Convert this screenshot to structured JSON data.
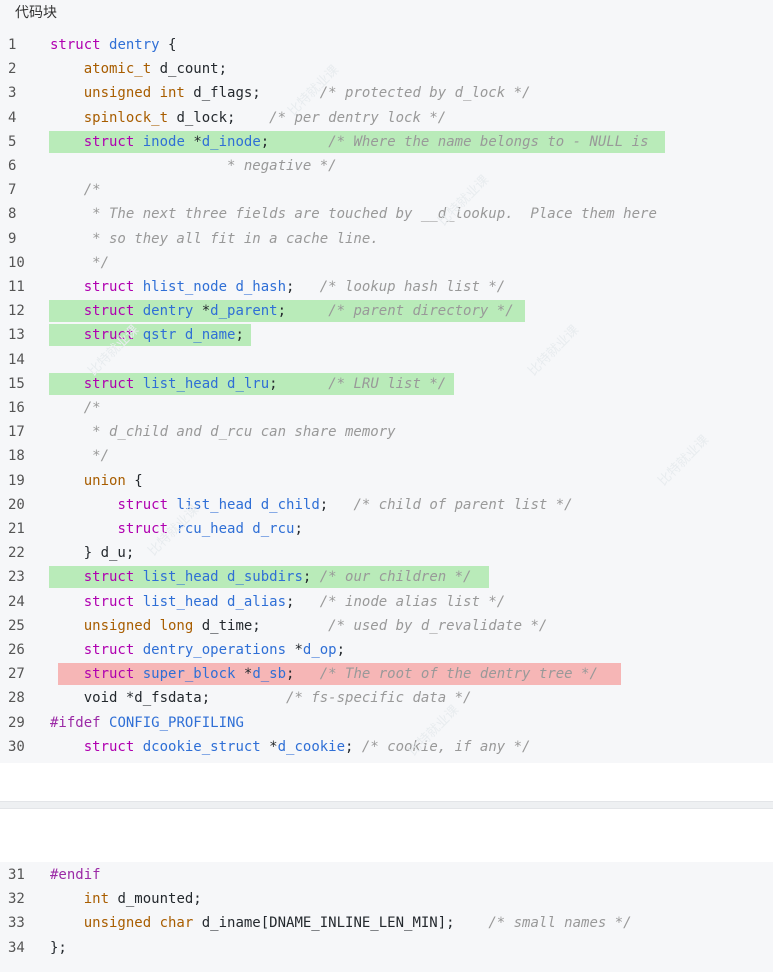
{
  "header": {
    "title": "代码块"
  },
  "code_block_1": {
    "lines": [
      {
        "num": "1",
        "hl": "",
        "tokens": [
          {
            "c": "st",
            "t": "struct "
          },
          {
            "c": "ty",
            "t": "dentry"
          },
          {
            "c": "pl",
            "t": " {"
          }
        ]
      },
      {
        "num": "2",
        "hl": "",
        "tokens": [
          {
            "c": "pl",
            "t": "    "
          },
          {
            "c": "kw",
            "t": "atomic_t"
          },
          {
            "c": "pl",
            "t": " d_count;"
          }
        ]
      },
      {
        "num": "3",
        "hl": "",
        "tokens": [
          {
            "c": "pl",
            "t": "    "
          },
          {
            "c": "kw",
            "t": "unsigned int"
          },
          {
            "c": "pl",
            "t": " d_flags;       "
          },
          {
            "c": "cm",
            "t": "/* protected by d_lock */"
          }
        ]
      },
      {
        "num": "4",
        "hl": "",
        "tokens": [
          {
            "c": "pl",
            "t": "    "
          },
          {
            "c": "kw",
            "t": "spinlock_t"
          },
          {
            "c": "pl",
            "t": " d_lock;    "
          },
          {
            "c": "cm",
            "t": "/* per dentry lock */"
          }
        ]
      },
      {
        "num": "5",
        "hl": "green",
        "hlw": 616,
        "tokens": [
          {
            "c": "pl",
            "t": "    "
          },
          {
            "c": "st",
            "t": "struct "
          },
          {
            "c": "ty",
            "t": "inode"
          },
          {
            "c": "pl",
            "t": " *"
          },
          {
            "c": "ty",
            "t": "d_inode"
          },
          {
            "c": "pl",
            "t": ";       "
          },
          {
            "c": "cm",
            "t": "/* Where the name belongs to - NULL is"
          }
        ]
      },
      {
        "num": "6",
        "hl": "",
        "tokens": [
          {
            "c": "cm",
            "t": "                     * negative */"
          }
        ]
      },
      {
        "num": "7",
        "hl": "",
        "tokens": [
          {
            "c": "cm",
            "t": "    /*"
          }
        ]
      },
      {
        "num": "8",
        "hl": "",
        "tokens": [
          {
            "c": "cm",
            "t": "     * The next three fields are touched by __d_lookup.  Place them here"
          }
        ]
      },
      {
        "num": "9",
        "hl": "",
        "tokens": [
          {
            "c": "cm",
            "t": "     * so they all fit in a cache line."
          }
        ]
      },
      {
        "num": "10",
        "hl": "",
        "tokens": [
          {
            "c": "cm",
            "t": "     */"
          }
        ]
      },
      {
        "num": "11",
        "hl": "",
        "tokens": [
          {
            "c": "pl",
            "t": "    "
          },
          {
            "c": "st",
            "t": "struct "
          },
          {
            "c": "ty",
            "t": "hlist_node d_hash"
          },
          {
            "c": "pl",
            "t": ";   "
          },
          {
            "c": "cm",
            "t": "/* lookup hash list */"
          }
        ]
      },
      {
        "num": "12",
        "hl": "green",
        "hlw": 476,
        "tokens": [
          {
            "c": "pl",
            "t": "    "
          },
          {
            "c": "st",
            "t": "struct "
          },
          {
            "c": "ty",
            "t": "dentry"
          },
          {
            "c": "pl",
            "t": " *"
          },
          {
            "c": "ty",
            "t": "d_parent"
          },
          {
            "c": "pl",
            "t": ";     "
          },
          {
            "c": "cm",
            "t": "/* parent directory */"
          }
        ]
      },
      {
        "num": "13",
        "hl": "green",
        "hlw": 202,
        "tokens": [
          {
            "c": "pl",
            "t": "    "
          },
          {
            "c": "st",
            "t": "struct "
          },
          {
            "c": "ty",
            "t": "qstr d_name"
          },
          {
            "c": "pl",
            "t": ";"
          }
        ]
      },
      {
        "num": "14",
        "hl": "",
        "tokens": [
          {
            "c": "pl",
            "t": ""
          }
        ]
      },
      {
        "num": "15",
        "hl": "green",
        "hlw": 405,
        "tokens": [
          {
            "c": "pl",
            "t": "    "
          },
          {
            "c": "st",
            "t": "struct "
          },
          {
            "c": "ty",
            "t": "list_head d_lru"
          },
          {
            "c": "pl",
            "t": ";      "
          },
          {
            "c": "cm",
            "t": "/* LRU list */"
          }
        ]
      },
      {
        "num": "16",
        "hl": "",
        "tokens": [
          {
            "c": "cm",
            "t": "    /*"
          }
        ]
      },
      {
        "num": "17",
        "hl": "",
        "tokens": [
          {
            "c": "cm",
            "t": "     * d_child and d_rcu can share memory"
          }
        ]
      },
      {
        "num": "18",
        "hl": "",
        "tokens": [
          {
            "c": "cm",
            "t": "     */"
          }
        ]
      },
      {
        "num": "19",
        "hl": "",
        "tokens": [
          {
            "c": "pl",
            "t": "    "
          },
          {
            "c": "kw",
            "t": "union"
          },
          {
            "c": "pl",
            "t": " {"
          }
        ]
      },
      {
        "num": "20",
        "hl": "",
        "tokens": [
          {
            "c": "pl",
            "t": "        "
          },
          {
            "c": "st",
            "t": "struct "
          },
          {
            "c": "ty",
            "t": "list_head d_child"
          },
          {
            "c": "pl",
            "t": ";   "
          },
          {
            "c": "cm",
            "t": "/* child of parent list */"
          }
        ]
      },
      {
        "num": "21",
        "hl": "",
        "tokens": [
          {
            "c": "pl",
            "t": "        "
          },
          {
            "c": "st",
            "t": "struct "
          },
          {
            "c": "ty",
            "t": "rcu_head d_rcu"
          },
          {
            "c": "pl",
            "t": ";"
          }
        ]
      },
      {
        "num": "22",
        "hl": "",
        "tokens": [
          {
            "c": "pl",
            "t": "    } d_u;"
          }
        ]
      },
      {
        "num": "23",
        "hl": "green",
        "hlw": 440,
        "tokens": [
          {
            "c": "pl",
            "t": "    "
          },
          {
            "c": "st",
            "t": "struct "
          },
          {
            "c": "ty",
            "t": "list_head d_subdirs"
          },
          {
            "c": "pl",
            "t": "; "
          },
          {
            "c": "cm",
            "t": "/* our children */"
          }
        ]
      },
      {
        "num": "24",
        "hl": "",
        "tokens": [
          {
            "c": "pl",
            "t": "    "
          },
          {
            "c": "st",
            "t": "struct "
          },
          {
            "c": "ty",
            "t": "list_head d_alias"
          },
          {
            "c": "pl",
            "t": ";   "
          },
          {
            "c": "cm",
            "t": "/* inode alias list */"
          }
        ]
      },
      {
        "num": "25",
        "hl": "",
        "tokens": [
          {
            "c": "pl",
            "t": "    "
          },
          {
            "c": "kw",
            "t": "unsigned long"
          },
          {
            "c": "pl",
            "t": " d_time;        "
          },
          {
            "c": "cm",
            "t": "/* used by d_revalidate */"
          }
        ]
      },
      {
        "num": "26",
        "hl": "",
        "tokens": [
          {
            "c": "pl",
            "t": "    "
          },
          {
            "c": "st",
            "t": "struct "
          },
          {
            "c": "ty",
            "t": "dentry_operations"
          },
          {
            "c": "pl",
            "t": " *"
          },
          {
            "c": "ty",
            "t": "d_op"
          },
          {
            "c": "pl",
            "t": ";"
          }
        ]
      },
      {
        "num": "27",
        "hl": "red",
        "hlw": 563,
        "tokens": [
          {
            "c": "pl",
            "t": "    "
          },
          {
            "c": "st",
            "t": "struct "
          },
          {
            "c": "ty",
            "t": "super_block"
          },
          {
            "c": "pl",
            "t": " *"
          },
          {
            "c": "ty",
            "t": "d_sb"
          },
          {
            "c": "pl",
            "t": ";   "
          },
          {
            "c": "cm",
            "t": "/* The root of the dentry tree */"
          }
        ]
      },
      {
        "num": "28",
        "hl": "",
        "tokens": [
          {
            "c": "pl",
            "t": "    void *d_fsdata;         "
          },
          {
            "c": "cm",
            "t": "/* fs-specific data */"
          }
        ]
      },
      {
        "num": "29",
        "hl": "",
        "tokens": [
          {
            "c": "pp",
            "t": "#ifdef "
          },
          {
            "c": "ty",
            "t": "CONFIG_PROFILING"
          }
        ]
      },
      {
        "num": "30",
        "hl": "",
        "tokens": [
          {
            "c": "pl",
            "t": "    "
          },
          {
            "c": "st",
            "t": "struct "
          },
          {
            "c": "ty",
            "t": "dcookie_struct"
          },
          {
            "c": "pl",
            "t": " *"
          },
          {
            "c": "ty",
            "t": "d_cookie"
          },
          {
            "c": "pl",
            "t": "; "
          },
          {
            "c": "cm",
            "t": "/* cookie, if any */"
          }
        ]
      }
    ]
  },
  "code_block_2": {
    "lines": [
      {
        "num": "31",
        "hl": "",
        "tokens": [
          {
            "c": "pp",
            "t": "#endif"
          }
        ]
      },
      {
        "num": "32",
        "hl": "",
        "tokens": [
          {
            "c": "pl",
            "t": "    "
          },
          {
            "c": "kw",
            "t": "int"
          },
          {
            "c": "pl",
            "t": " d_mounted;"
          }
        ]
      },
      {
        "num": "33",
        "hl": "",
        "tokens": [
          {
            "c": "pl",
            "t": "    "
          },
          {
            "c": "kw",
            "t": "unsigned char"
          },
          {
            "c": "pl",
            "t": " d_iname[DNAME_INLINE_LEN_MIN];    "
          },
          {
            "c": "cm",
            "t": "/* small names */"
          }
        ]
      },
      {
        "num": "34",
        "hl": "",
        "tokens": [
          {
            "c": "pl",
            "t": "};"
          }
        ]
      }
    ]
  },
  "watermark": {
    "text": "比特就业课"
  }
}
